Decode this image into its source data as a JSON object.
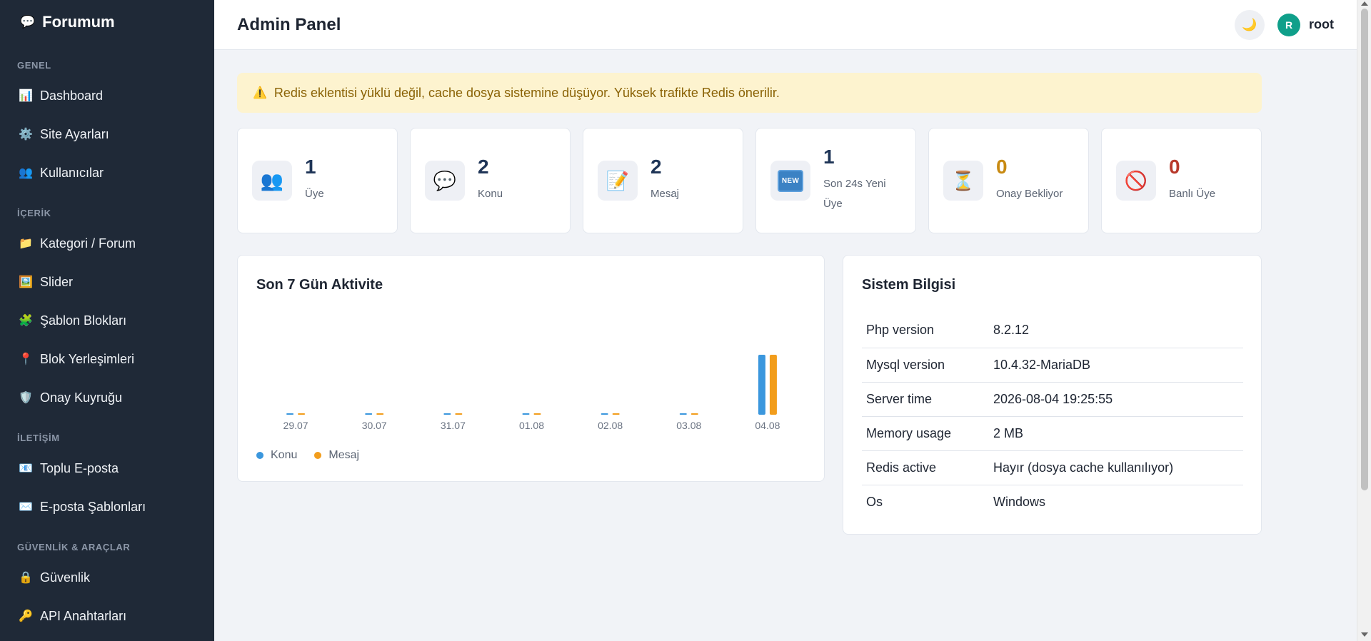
{
  "brand": {
    "icon": "speech-balloon-icon",
    "name": "Forumum"
  },
  "sidebar": {
    "sections": [
      {
        "title": "GENEL",
        "items": [
          {
            "icon": "bar-chart-icon",
            "glyph": "📊",
            "label": "Dashboard"
          },
          {
            "icon": "gear-icon",
            "glyph": "⚙️",
            "label": "Site Ayarları"
          },
          {
            "icon": "users-icon",
            "glyph": "👥",
            "label": "Kullanıcılar"
          }
        ]
      },
      {
        "title": "İÇERİK",
        "items": [
          {
            "icon": "folder-icon",
            "glyph": "📁",
            "label": "Kategori / Forum"
          },
          {
            "icon": "picture-icon",
            "glyph": "🖼️",
            "label": "Slider"
          },
          {
            "icon": "puzzle-icon",
            "glyph": "🧩",
            "label": "Şablon Blokları"
          },
          {
            "icon": "pin-icon",
            "glyph": "📍",
            "label": "Blok Yerleşimleri"
          },
          {
            "icon": "shield-icon",
            "glyph": "🛡️",
            "label": "Onay Kuyruğu"
          }
        ]
      },
      {
        "title": "İLETİŞİM",
        "items": [
          {
            "icon": "mass-mail-icon",
            "glyph": "📧",
            "label": "Toplu E-posta"
          },
          {
            "icon": "envelope-icon",
            "glyph": "✉️",
            "label": "E-posta Şablonları"
          }
        ]
      },
      {
        "title": "GÜVENLİK & ARAÇLAR",
        "items": [
          {
            "icon": "lock-icon",
            "glyph": "🔒",
            "label": "Güvenlik"
          },
          {
            "icon": "key-icon",
            "glyph": "🔑",
            "label": "API Anahtarları"
          }
        ]
      }
    ]
  },
  "header": {
    "title": "Admin Panel",
    "theme_icon": "moon-icon",
    "user": {
      "initial": "R",
      "name": "root"
    }
  },
  "alert": {
    "icon": "warning-icon",
    "text": "Redis eklentisi yüklü değil, cache dosya sistemine düşüyor. Yüksek trafikte Redis önerilir."
  },
  "stats": [
    {
      "icon": "users-icon",
      "glyph": "👥",
      "value": "1",
      "label": "Üye",
      "tone": "default"
    },
    {
      "icon": "speech-balloon-icon",
      "glyph": "💬",
      "value": "2",
      "label": "Konu",
      "tone": "default"
    },
    {
      "icon": "memo-icon",
      "glyph": "📝",
      "value": "2",
      "label": "Mesaj",
      "tone": "default"
    },
    {
      "icon": "new-badge-icon",
      "badge": "NEW",
      "value": "1",
      "label": "Son 24s Yeni Üye",
      "tone": "default"
    },
    {
      "icon": "hourglass-icon",
      "glyph": "⏳",
      "value": "0",
      "label": "Onay Bekliyor",
      "tone": "warn"
    },
    {
      "icon": "prohibited-icon",
      "glyph": "🚫",
      "value": "0",
      "label": "Banlı Üye",
      "tone": "danger"
    }
  ],
  "activity": {
    "title": "Son 7 Gün Aktivite"
  },
  "chart_data": {
    "type": "bar",
    "categories": [
      "29.07",
      "30.07",
      "31.07",
      "01.08",
      "02.08",
      "03.08",
      "04.08"
    ],
    "series": [
      {
        "name": "Konu",
        "color": "#3b97dd",
        "values": [
          0,
          0,
          0,
          0,
          0,
          0,
          2
        ]
      },
      {
        "name": "Mesaj",
        "color": "#f29d1c",
        "values": [
          0,
          0,
          0,
          0,
          0,
          0,
          2
        ]
      }
    ],
    "ylim": [
      0,
      2
    ],
    "grid": false,
    "legend": "bottom-left"
  },
  "system": {
    "title": "Sistem Bilgisi",
    "rows": [
      {
        "key": "Php version",
        "value": "8.2.12"
      },
      {
        "key": "Mysql version",
        "value": "10.4.32-MariaDB"
      },
      {
        "key": "Server time",
        "value": "2026-08-04 19:25:55"
      },
      {
        "key": "Memory usage",
        "value": "2 MB"
      },
      {
        "key": "Redis active",
        "value": "Hayır (dosya cache kullanılıyor)"
      },
      {
        "key": "Os",
        "value": "Windows"
      }
    ]
  }
}
